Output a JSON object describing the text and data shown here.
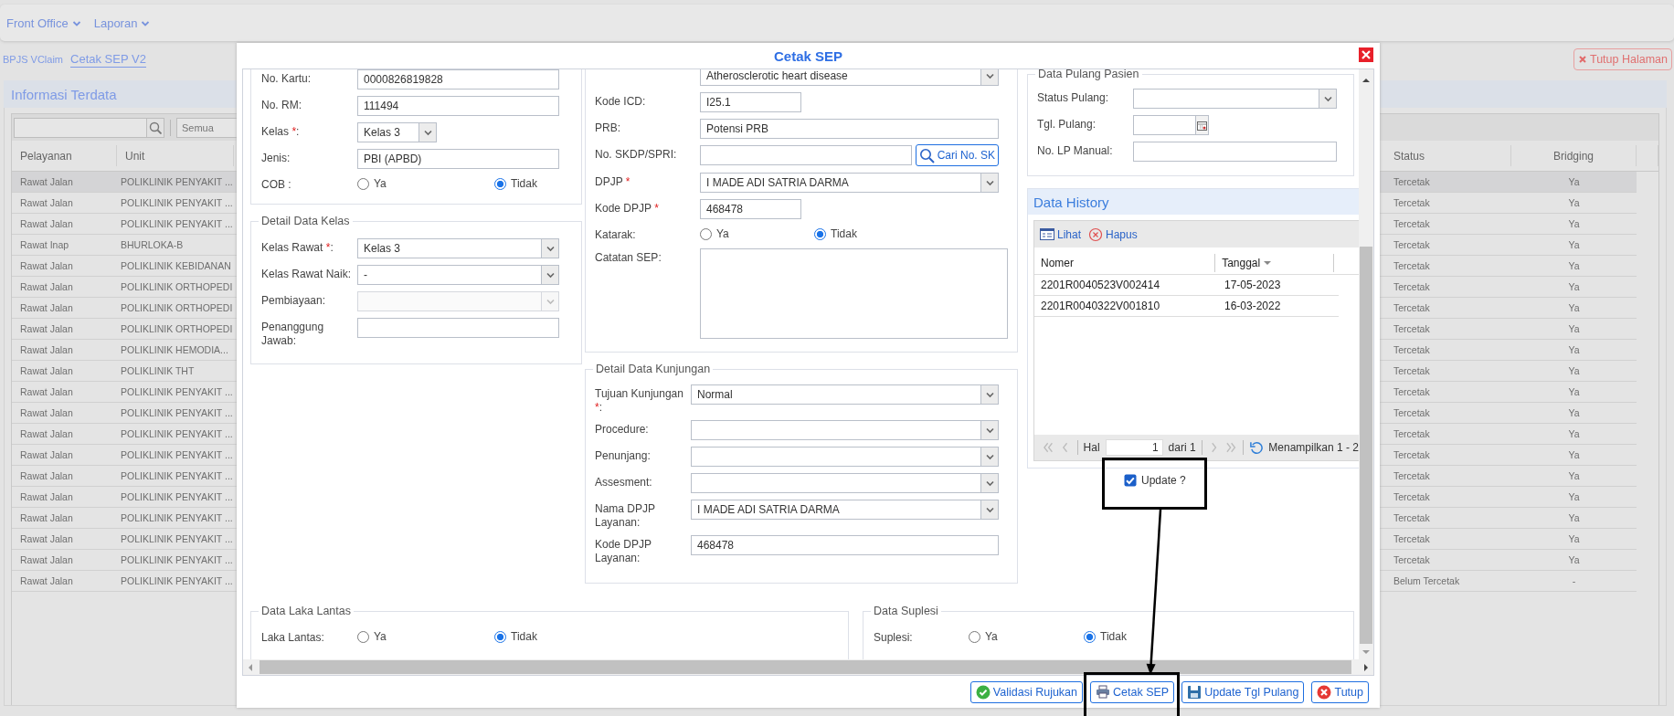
{
  "nav": {
    "menus": [
      {
        "label": "Front Office"
      },
      {
        "label": "Laporan"
      }
    ]
  },
  "breadcrumb": [
    {
      "label": "BPJS VClaim",
      "selected": false
    },
    {
      "label": "Cetak SEP V2",
      "selected": true
    }
  ],
  "close_page_button": "Tutup Halaman",
  "panel": {
    "title": "Informasi Terdata",
    "filter": "Semua",
    "table": {
      "columns": [
        "Pelayanan",
        "Unit",
        "Status",
        "Bridging"
      ],
      "rows": [
        {
          "cells": [
            "Rawat Jalan",
            "POLIKLINIK PENYAKIT ...",
            "Tercetak",
            "Ya"
          ],
          "selected": true
        },
        {
          "cells": [
            "Rawat Jalan",
            "POLIKLINIK PENYAKIT ...",
            "Tercetak",
            "Ya"
          ],
          "selected": false
        },
        {
          "cells": [
            "Rawat Jalan",
            "POLIKLINIK PENYAKIT ...",
            "Tercetak",
            "Ya"
          ],
          "selected": false
        },
        {
          "cells": [
            "Rawat Inap",
            "BHURLOKA-B",
            "Tercetak",
            "Ya"
          ],
          "selected": false
        },
        {
          "cells": [
            "Rawat Jalan",
            "POLIKLINIK KEBIDANAN",
            "Tercetak",
            "Ya"
          ],
          "selected": false
        },
        {
          "cells": [
            "Rawat Jalan",
            "POLIKLINIK ORTHOPEDI",
            "Tercetak",
            "Ya"
          ],
          "selected": false
        },
        {
          "cells": [
            "Rawat Jalan",
            "POLIKLINIK ORTHOPEDI",
            "Tercetak",
            "Ya"
          ],
          "selected": false
        },
        {
          "cells": [
            "Rawat Jalan",
            "POLIKLINIK ORTHOPEDI",
            "Tercetak",
            "Ya"
          ],
          "selected": false
        },
        {
          "cells": [
            "Rawat Jalan",
            "POLIKLINIK HEMODIA...",
            "Tercetak",
            "Ya"
          ],
          "selected": false
        },
        {
          "cells": [
            "Rawat Jalan",
            "POLIKLINIK THT",
            "Tercetak",
            "Ya"
          ],
          "selected": false
        },
        {
          "cells": [
            "Rawat Jalan",
            "POLIKLINIK PENYAKIT ...",
            "Tercetak",
            "Ya"
          ],
          "selected": false
        },
        {
          "cells": [
            "Rawat Jalan",
            "POLIKLINIK PENYAKIT ...",
            "Tercetak",
            "Ya"
          ],
          "selected": false
        },
        {
          "cells": [
            "Rawat Jalan",
            "POLIKLINIK PENYAKIT ...",
            "Tercetak",
            "Ya"
          ],
          "selected": false
        },
        {
          "cells": [
            "Rawat Jalan",
            "POLIKLINIK PENYAKIT ...",
            "Tercetak",
            "Ya"
          ],
          "selected": false
        },
        {
          "cells": [
            "Rawat Jalan",
            "POLIKLINIK PENYAKIT ...",
            "Tercetak",
            "Ya"
          ],
          "selected": false
        },
        {
          "cells": [
            "Rawat Jalan",
            "POLIKLINIK PENYAKIT ...",
            "Tercetak",
            "Ya"
          ],
          "selected": false
        },
        {
          "cells": [
            "Rawat Jalan",
            "POLIKLINIK PENYAKIT ...",
            "Tercetak",
            "Ya"
          ],
          "selected": false
        },
        {
          "cells": [
            "Rawat Jalan",
            "POLIKLINIK PENYAKIT ...",
            "Tercetak",
            "Ya"
          ],
          "selected": false
        },
        {
          "cells": [
            "Rawat Jalan",
            "POLIKLINIK PENYAKIT ...",
            "Tercetak",
            "Ya"
          ],
          "selected": false
        },
        {
          "cells": [
            "Rawat Jalan",
            "POLIKLINIK PENYAKIT ...",
            "Belum Tercetak",
            "-"
          ],
          "selected": false
        }
      ]
    }
  },
  "dialog": {
    "title": "Cetak SEP",
    "left": [
      {
        "rows": [
          {
            "kind": "text",
            "label": "No. Kartu:",
            "value": "0000826819828"
          },
          {
            "kind": "text",
            "label": "No. RM:",
            "value": "111494"
          },
          {
            "kind": "shortselect",
            "label": "Kelas",
            "required_mark": "*",
            "label_end": ":",
            "value": "Kelas 3"
          },
          {
            "kind": "text",
            "label": "Jenis:",
            "value": "PBI (APBD)"
          },
          {
            "kind": "radio",
            "label": "COB :",
            "options": [
              {
                "label": "Ya",
                "selected": false
              },
              {
                "label": "Tidak",
                "selected": true
              }
            ]
          }
        ]
      },
      {
        "legend": "Detail Data Kelas",
        "rows": [
          {
            "kind": "select",
            "label": "Kelas Rawat",
            "required_mark": "*",
            "label_end": ":",
            "value": "Kelas 3"
          },
          {
            "kind": "select",
            "label": "Kelas Rawat Naik:",
            "value": "-"
          },
          {
            "kind": "select",
            "label": "Pembiayaan:",
            "disabled": true
          },
          {
            "kind": "text",
            "label": "Penanggung Jawab:"
          }
        ]
      }
    ],
    "middle": [
      {
        "rows": [
          {
            "kind": "select",
            "value": "Atherosclerotic heart disease"
          },
          {
            "kind": "shorttext",
            "label": "Kode ICD:",
            "value": "I25.1"
          },
          {
            "kind": "text",
            "label": "PRB:",
            "value": "Potensi PRB"
          },
          {
            "kind": "search",
            "label": "No. SKDP/SPRI:",
            "button": "Cari No. SK"
          },
          {
            "kind": "select",
            "label": "DPJP",
            "required_mark": "*",
            "value": "I MADE ADI SATRIA DARMA"
          },
          {
            "kind": "shorttext",
            "label": "Kode DPJP",
            "required_mark": "*",
            "value": "468478"
          },
          {
            "kind": "radio",
            "label": "Katarak:",
            "options": [
              {
                "label": "Ya",
                "selected": false
              },
              {
                "label": "Tidak",
                "selected": true
              }
            ]
          },
          {
            "kind": "textarea",
            "label": "Catatan SEP:"
          }
        ]
      },
      {
        "legend": "Detail Data Kunjungan",
        "rows": [
          {
            "kind": "select",
            "label": "Tujuan Kunjungan",
            "required_mark": "*",
            "label_end": ":",
            "value": "Normal"
          },
          {
            "kind": "select",
            "label": "Procedure:"
          },
          {
            "kind": "select",
            "label": "Penunjang:"
          },
          {
            "kind": "select",
            "label": "Assesment:"
          },
          {
            "kind": "select",
            "label": "Nama DPJP Layanan:",
            "value": "I MADE ADI SATRIA DARMA"
          },
          {
            "kind": "text",
            "label": "Kode DPJP Layanan:",
            "value": "468478"
          }
        ]
      }
    ],
    "right": [
      {
        "legend": "Data Pulang Pasien",
        "rows": [
          {
            "kind": "select",
            "label": "Status Pulang:"
          },
          {
            "kind": "date",
            "label": "Tgl. Pulang:"
          },
          {
            "kind": "text",
            "label": "No. LP Manual:"
          }
        ]
      }
    ],
    "history": {
      "title": "Data History",
      "tools": [
        {
          "kind": "view",
          "label": "Lihat"
        },
        {
          "kind": "delete",
          "label": "Hapus"
        }
      ],
      "columns": [
        {
          "label": "Nomer",
          "sorted": false
        },
        {
          "label": "Tanggal",
          "sorted": true
        }
      ],
      "rows": [
        [
          "2201R0040523V002414",
          "17-05-2023"
        ],
        [
          "2201R0040322V001810",
          "16-03-2022"
        ]
      ],
      "pager": {
        "page_label": "Hal",
        "page": "1",
        "page_count": "dari 1",
        "info": "Menampilkan 1 - 2"
      }
    },
    "update": {
      "label": "Update ?",
      "checked": true,
      "highlighted": true
    },
    "bottom": [
      {
        "legend": "Data Laka Lantas",
        "rows": [
          {
            "kind": "radio",
            "label": "Laka Lantas:",
            "options": [
              {
                "label": "Ya",
                "selected": false
              },
              {
                "label": "Tidak",
                "selected": true
              }
            ]
          }
        ]
      },
      {
        "legend": "Data Suplesi",
        "rows": [
          {
            "kind": "radio",
            "label": "Suplesi:",
            "options": [
              {
                "label": "Ya",
                "selected": false
              },
              {
                "label": "Tidak",
                "selected": true
              }
            ]
          }
        ]
      }
    ],
    "buttons": [
      {
        "kind": "validate",
        "label": "Validasi Rujukan",
        "highlighted": false
      },
      {
        "kind": "print",
        "label": "Cetak SEP",
        "highlighted": true
      },
      {
        "kind": "save",
        "label": "Update Tgl Pulang",
        "highlighted": false
      },
      {
        "kind": "close",
        "label": "Tutup",
        "highlighted": false
      }
    ],
    "callout_arrow": true
  }
}
